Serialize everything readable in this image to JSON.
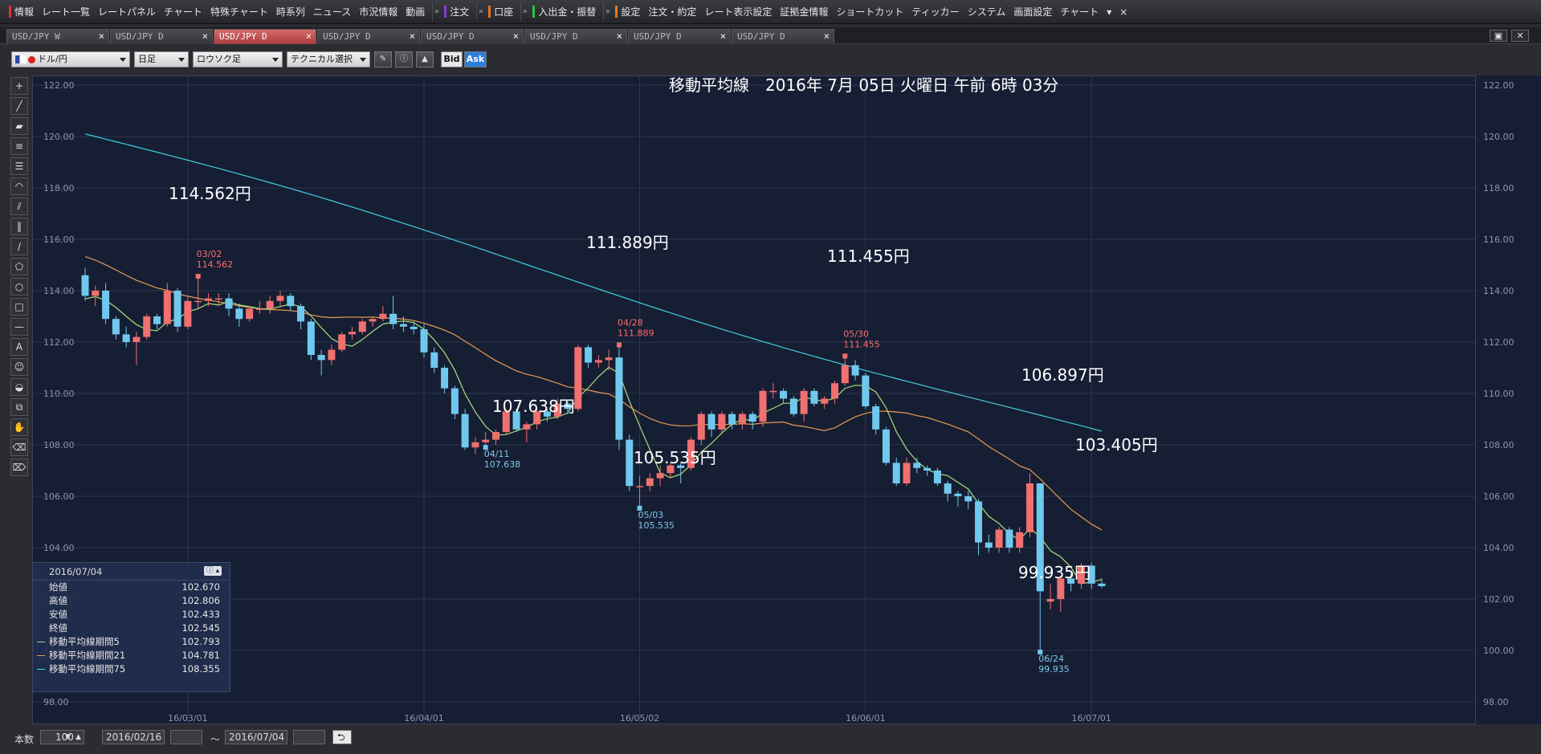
{
  "menubar": {
    "items": [
      {
        "label": "情報",
        "bar": "#e03030"
      },
      {
        "label": "レート一覧"
      },
      {
        "label": "レートパネル"
      },
      {
        "label": "チャート"
      },
      {
        "label": "特殊チャート"
      },
      {
        "label": "時系列"
      },
      {
        "label": "ニュース"
      },
      {
        "label": "市況情報"
      },
      {
        "label": "動画"
      },
      {
        "label": "注文",
        "bar": "#8a3ad8",
        "sep": true
      },
      {
        "label": "口座",
        "bar": "#e07a20",
        "sep": true
      },
      {
        "label": "入出金・振替",
        "bar": "#30c040",
        "sep": true
      },
      {
        "label": "設定",
        "bar": "#e07a20",
        "sep": true
      },
      {
        "label": "注文・約定"
      },
      {
        "label": "レート表示設定"
      },
      {
        "label": "証拠金情報"
      },
      {
        "label": "ショートカット"
      },
      {
        "label": "ティッカー"
      },
      {
        "label": "システム"
      },
      {
        "label": "画面設定"
      },
      {
        "label": "チャート"
      }
    ],
    "more": "▾",
    "close": "×"
  },
  "tabs": [
    {
      "label": "USD/JPY W",
      "close": "×",
      "active": false
    },
    {
      "label": "USD/JPY D",
      "close": "×",
      "active": false
    },
    {
      "label": "USD/JPY D",
      "close": "×",
      "active": true
    },
    {
      "label": "USD/JPY D",
      "close": "×",
      "active": false
    },
    {
      "label": "USD/JPY D",
      "close": "×",
      "active": false
    },
    {
      "label": "USD/JPY D",
      "close": "×",
      "active": false
    },
    {
      "label": "USD/JPY D",
      "close": "×",
      "active": false
    },
    {
      "label": "USD/JPY D",
      "close": "×",
      "active": false
    }
  ],
  "toolbar": {
    "pair": "ドル/円",
    "period": "日足",
    "chart_type": "ロウソク足",
    "technical": "テクニカル選択",
    "bid": "Bid",
    "ask": "Ask"
  },
  "chart": {
    "title": "移動平均線　2016年 7月 05日 火曜日 午前 6時 03分",
    "y_ticks": [
      "122.00",
      "120.00",
      "118.00",
      "116.00",
      "114.00",
      "112.00",
      "110.00",
      "108.00",
      "106.00",
      "104.00",
      "102.00",
      "100.00",
      "98.00"
    ],
    "x_ticks": [
      "16/03/01",
      "16/04/01",
      "16/05/02",
      "16/06/01",
      "16/07/01"
    ],
    "callouts": [
      {
        "big": "114.562円",
        "date": "03/02",
        "value": "114.562",
        "kind": "high"
      },
      {
        "big": "107.638円",
        "date": "04/11",
        "value": "107.638",
        "kind": "low"
      },
      {
        "big": "111.889円",
        "date": "04/28",
        "value": "111.889",
        "kind": "high"
      },
      {
        "big": "105.535円",
        "date": "05/03",
        "value": "105.535",
        "kind": "low"
      },
      {
        "big": "111.455円",
        "date": "05/30",
        "value": "111.455",
        "kind": "high"
      },
      {
        "big": "106.897円",
        "date": "",
        "value": "",
        "kind": "label"
      },
      {
        "big": "103.405円",
        "date": "",
        "value": "",
        "kind": "label"
      },
      {
        "big": "99.935円",
        "date": "06/24",
        "value": "99.935",
        "kind": "low"
      }
    ],
    "colors": {
      "background": "#161e33",
      "grid": "#2c3650",
      "up": "#f07070",
      "down": "#70c8ef",
      "ma5": "#a8e07a",
      "ma21": "#e89a50",
      "ma75": "#40d0e0"
    }
  },
  "info_panel": {
    "date": "2016/07/04",
    "rows": [
      {
        "label": "始値",
        "value": "102.670"
      },
      {
        "label": "高値",
        "value": "102.806"
      },
      {
        "label": "安値",
        "value": "102.433"
      },
      {
        "label": "終値",
        "value": "102.545"
      },
      {
        "label": "移動平均線期間5",
        "value": "102.793",
        "color": "#a8e07a"
      },
      {
        "label": "移動平均線期間21",
        "value": "104.781",
        "color": "#e89a50"
      },
      {
        "label": "移動平均線期間75",
        "value": "108.355",
        "color": "#40d0e0"
      }
    ]
  },
  "bottom": {
    "count_label": "本数",
    "count_value": "100",
    "from_date": "2016/02/16",
    "tilde": "〜",
    "to_date": "2016/07/04"
  },
  "chart_data": {
    "type": "candlestick",
    "title": "移動平均線　2016年 7月 05日 火曜日 午前 6時 03分",
    "ylim": [
      97,
      123
    ],
    "dates": [
      "16/02/16",
      "16/02/17",
      "16/02/18",
      "16/02/19",
      "16/02/22",
      "16/02/23",
      "16/02/24",
      "16/02/25",
      "16/02/26",
      "16/02/29",
      "16/03/01",
      "16/03/02",
      "16/03/03",
      "16/03/04",
      "16/03/07",
      "16/03/08",
      "16/03/09",
      "16/03/10",
      "16/03/11",
      "16/03/14",
      "16/03/15",
      "16/03/16",
      "16/03/17",
      "16/03/18",
      "16/03/21",
      "16/03/22",
      "16/03/23",
      "16/03/24",
      "16/03/25",
      "16/03/28",
      "16/03/29",
      "16/03/30",
      "16/03/31",
      "16/04/01",
      "16/04/04",
      "16/04/05",
      "16/04/06",
      "16/04/07",
      "16/04/08",
      "16/04/11",
      "16/04/12",
      "16/04/13",
      "16/04/14",
      "16/04/15",
      "16/04/18",
      "16/04/19",
      "16/04/20",
      "16/04/21",
      "16/04/22",
      "16/04/25",
      "16/04/26",
      "16/04/27",
      "16/04/28",
      "16/04/29",
      "16/05/02",
      "16/05/03",
      "16/05/04",
      "16/05/05",
      "16/05/06",
      "16/05/09",
      "16/05/10",
      "16/05/11",
      "16/05/12",
      "16/05/13",
      "16/05/16",
      "16/05/17",
      "16/05/18",
      "16/05/19",
      "16/05/20",
      "16/05/23",
      "16/05/24",
      "16/05/25",
      "16/05/26",
      "16/05/27",
      "16/05/30",
      "16/05/31",
      "16/06/01",
      "16/06/02",
      "16/06/03",
      "16/06/06",
      "16/06/07",
      "16/06/08",
      "16/06/09",
      "16/06/10",
      "16/06/13",
      "16/06/14",
      "16/06/15",
      "16/06/16",
      "16/06/17",
      "16/06/20",
      "16/06/21",
      "16/06/22",
      "16/06/23",
      "16/06/24",
      "16/06/27",
      "16/06/28",
      "16/06/29",
      "16/06/30",
      "16/07/01",
      "16/07/04"
    ],
    "open": [
      114.6,
      113.8,
      114.0,
      112.9,
      112.3,
      112.0,
      112.2,
      113.0,
      112.7,
      114.0,
      112.6,
      113.6,
      113.6,
      113.7,
      113.7,
      113.3,
      112.9,
      113.3,
      113.3,
      113.6,
      113.8,
      113.4,
      112.8,
      111.5,
      111.3,
      111.7,
      112.3,
      112.4,
      112.8,
      112.9,
      113.1,
      112.7,
      112.6,
      112.5,
      111.6,
      111.0,
      110.2,
      109.2,
      107.9,
      108.1,
      108.2,
      108.5,
      109.3,
      108.6,
      108.8,
      109.3,
      109.1,
      109.6,
      109.4,
      111.8,
      111.2,
      111.3,
      111.4,
      108.2,
      106.4,
      106.4,
      106.7,
      106.9,
      107.2,
      107.1,
      108.2,
      109.2,
      108.6,
      109.2,
      108.8,
      109.2,
      108.9,
      110.1,
      110.1,
      109.8,
      109.2,
      110.1,
      109.6,
      109.8,
      110.4,
      111.1,
      110.7,
      109.5,
      108.6,
      107.3,
      106.5,
      107.3,
      107.1,
      107.0,
      106.5,
      106.1,
      106.0,
      105.8,
      104.2,
      104.0,
      104.7,
      104.0,
      104.6,
      106.5,
      101.9,
      102.0,
      102.8,
      102.6,
      103.3,
      102.6
    ],
    "close": [
      113.8,
      114.0,
      112.9,
      112.3,
      112.0,
      112.2,
      113.0,
      112.7,
      114.0,
      112.6,
      113.6,
      113.6,
      113.7,
      113.7,
      113.3,
      112.9,
      113.3,
      113.3,
      113.6,
      113.8,
      113.4,
      112.8,
      111.5,
      111.3,
      111.7,
      112.3,
      112.4,
      112.8,
      112.9,
      113.1,
      112.7,
      112.6,
      112.5,
      111.6,
      111.0,
      110.2,
      109.2,
      107.9,
      108.1,
      108.2,
      108.5,
      109.3,
      108.6,
      108.8,
      109.3,
      109.1,
      109.6,
      109.4,
      111.8,
      111.2,
      111.3,
      111.4,
      108.2,
      106.4,
      106.4,
      106.7,
      106.9,
      107.2,
      107.1,
      108.2,
      109.2,
      108.6,
      109.2,
      108.8,
      109.2,
      108.9,
      110.1,
      110.1,
      109.8,
      109.2,
      110.1,
      109.6,
      109.8,
      110.4,
      111.1,
      110.7,
      109.5,
      108.6,
      107.3,
      106.5,
      107.3,
      107.1,
      107.0,
      106.5,
      106.1,
      106.0,
      105.8,
      104.2,
      104.0,
      104.7,
      104.0,
      104.6,
      106.5,
      102.3,
      102.0,
      102.8,
      102.6,
      103.3,
      102.6,
      102.5
    ],
    "high": [
      114.9,
      114.2,
      114.3,
      113.0,
      112.6,
      112.4,
      113.1,
      113.1,
      114.3,
      114.1,
      113.8,
      114.562,
      113.9,
      113.9,
      113.9,
      113.5,
      113.4,
      113.6,
      113.8,
      114.0,
      113.9,
      113.5,
      112.9,
      111.7,
      111.9,
      112.4,
      112.6,
      112.9,
      113.0,
      113.4,
      113.8,
      113.0,
      112.8,
      112.7,
      111.8,
      111.1,
      110.3,
      109.4,
      108.3,
      108.5,
      108.6,
      109.4,
      109.4,
      108.9,
      109.4,
      109.4,
      109.8,
      109.7,
      111.9,
      111.9,
      111.5,
      111.7,
      111.889,
      108.4,
      106.8,
      106.9,
      107.2,
      107.3,
      107.3,
      108.3,
      109.3,
      109.3,
      109.3,
      109.3,
      109.3,
      109.3,
      110.2,
      110.4,
      110.2,
      109.9,
      110.2,
      110.2,
      109.9,
      110.5,
      111.455,
      111.3,
      110.8,
      109.6,
      108.7,
      107.5,
      107.5,
      107.5,
      107.2,
      107.1,
      106.6,
      106.2,
      106.2,
      105.9,
      104.5,
      104.8,
      104.8,
      104.8,
      106.897,
      106.5,
      102.6,
      102.9,
      103.0,
      103.4,
      103.405,
      102.806
    ],
    "low": [
      113.6,
      113.4,
      112.7,
      112.1,
      111.8,
      111.1,
      112.1,
      112.5,
      112.6,
      112.4,
      112.5,
      113.3,
      113.4,
      113.4,
      113.0,
      112.6,
      112.8,
      113.1,
      113.1,
      113.4,
      113.2,
      112.5,
      111.3,
      110.7,
      111.1,
      111.6,
      112.1,
      112.3,
      112.6,
      112.8,
      112.5,
      112.4,
      112.3,
      111.4,
      110.8,
      110.0,
      109.0,
      107.8,
      107.638,
      107.9,
      108.0,
      108.4,
      108.5,
      108.1,
      108.6,
      108.9,
      109.0,
      109.2,
      109.3,
      111.0,
      111.0,
      110.9,
      107.8,
      106.2,
      105.535,
      106.2,
      106.4,
      106.7,
      106.5,
      107.0,
      108.0,
      108.3,
      108.4,
      108.6,
      108.6,
      108.6,
      108.7,
      109.8,
      109.6,
      109.1,
      108.9,
      109.5,
      109.4,
      109.6,
      110.3,
      110.5,
      109.4,
      108.4,
      107.2,
      106.4,
      106.4,
      106.9,
      106.8,
      106.4,
      105.8,
      105.6,
      105.5,
      103.7,
      103.8,
      103.8,
      103.8,
      103.8,
      104.4,
      99.935,
      101.6,
      101.5,
      102.3,
      102.4,
      102.4,
      102.433
    ],
    "ma5_start": 113.5,
    "ma21_start": 117.0,
    "ma75_start": 120.1,
    "ma5_end": 102.793,
    "ma21_end": 104.781,
    "ma75_end": 108.355
  }
}
